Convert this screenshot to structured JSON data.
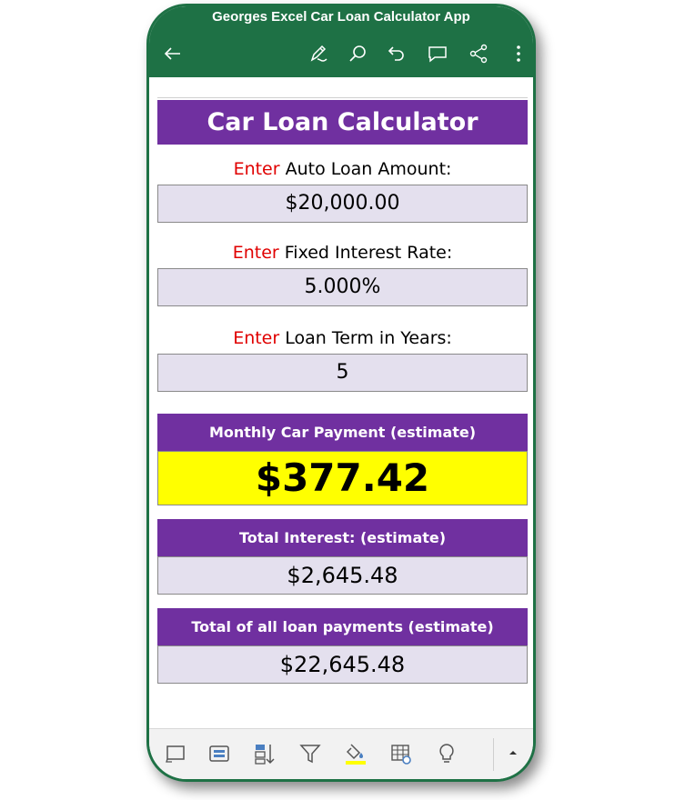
{
  "app": {
    "title": "Georges Excel Car Loan Calculator App"
  },
  "toolbar": {
    "icons": [
      "back-arrow-icon",
      "draw-pen-icon",
      "search-icon",
      "undo-icon",
      "comment-icon",
      "share-icon",
      "more-icon"
    ]
  },
  "calculator": {
    "title": "Car Loan Calculator",
    "enter_word": "Enter",
    "loan_amount_label": " Auto Loan Amount:",
    "loan_amount_value": "$20,000.00",
    "interest_rate_label": " Fixed Interest Rate:",
    "interest_rate_value": "5.000%",
    "loan_term_label": " Loan Term in Years:",
    "loan_term_value": "5",
    "monthly_payment_heading": "Monthly Car Payment (estimate)",
    "monthly_payment_value": "$377.42",
    "total_interest_heading": "Total Interest: (estimate)",
    "total_interest_value": "$2,645.48",
    "total_payments_heading": "Total of all loan payments (estimate)",
    "total_payments_value": "$22,645.48"
  },
  "bottom_toolbar": {
    "icons": [
      "slide-view-icon",
      "card-view-icon",
      "sort-icon",
      "filter-icon",
      "fill-color-icon",
      "table-icon",
      "ideas-bulb-icon",
      "expand-up-icon"
    ]
  },
  "colors": {
    "header_green": "#1e7145",
    "banner_purple": "#7030a0",
    "input_fill": "#e4e0ee",
    "result_yellow": "#ffff00",
    "enter_red": "#e00000",
    "fill_color_underline": "#ffff00"
  }
}
